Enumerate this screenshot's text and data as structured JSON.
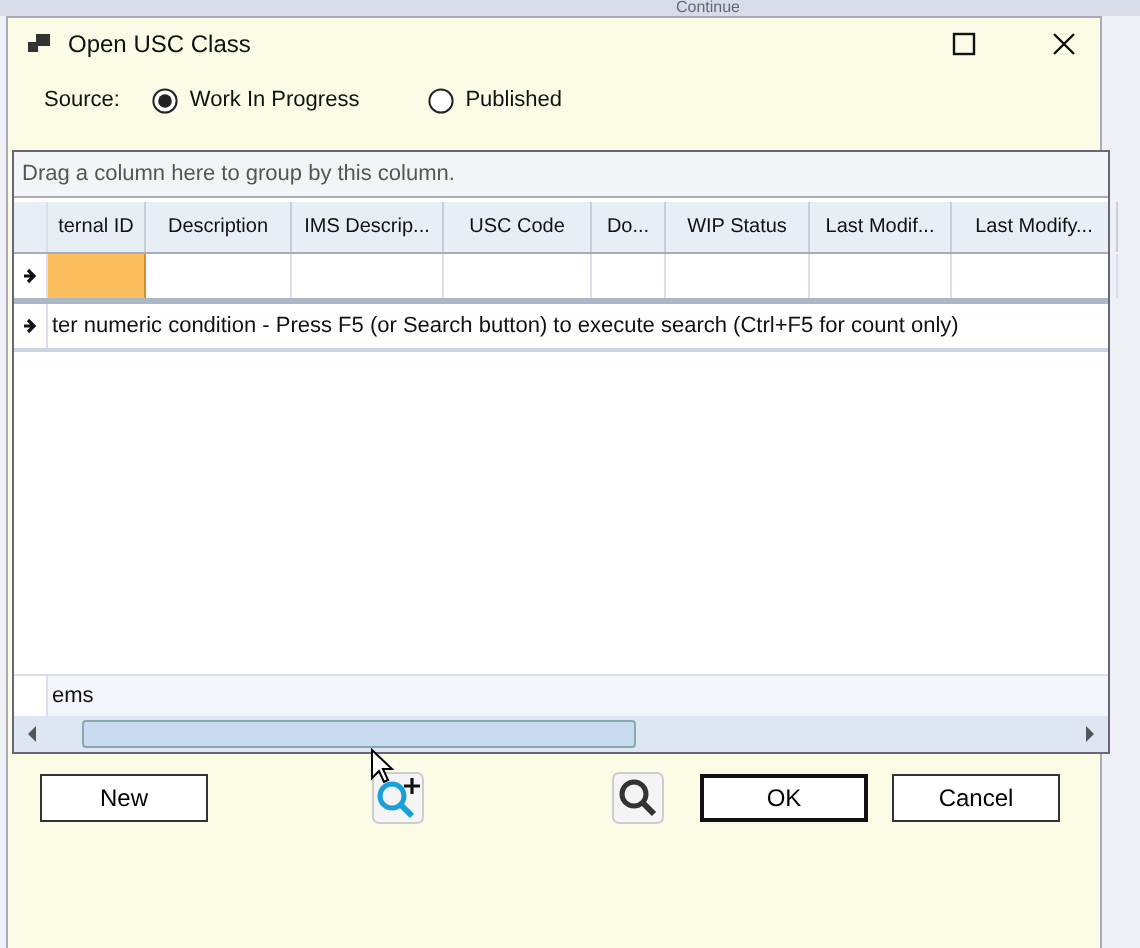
{
  "background": {
    "toolbar_label": "Continue"
  },
  "window": {
    "title": "Open USC Class"
  },
  "source": {
    "label": "Source:",
    "options": [
      {
        "label": "Work In Progress",
        "selected": true
      },
      {
        "label": "Published",
        "selected": false
      }
    ]
  },
  "grid": {
    "group_hint": "Drag a column here to group by this column.",
    "columns": [
      "ternal ID",
      "Description",
      "IMS Descrip...",
      "USC Code",
      "Do...",
      "WIP Status",
      "Last Modif...",
      "Last Modify..."
    ],
    "filter_hint": "ter numeric condition - Press F5 (or Search button) to execute search (Ctrl+F5 for count only)",
    "footer": "ems"
  },
  "buttons": {
    "new": "New",
    "ok": "OK",
    "cancel": "Cancel"
  }
}
